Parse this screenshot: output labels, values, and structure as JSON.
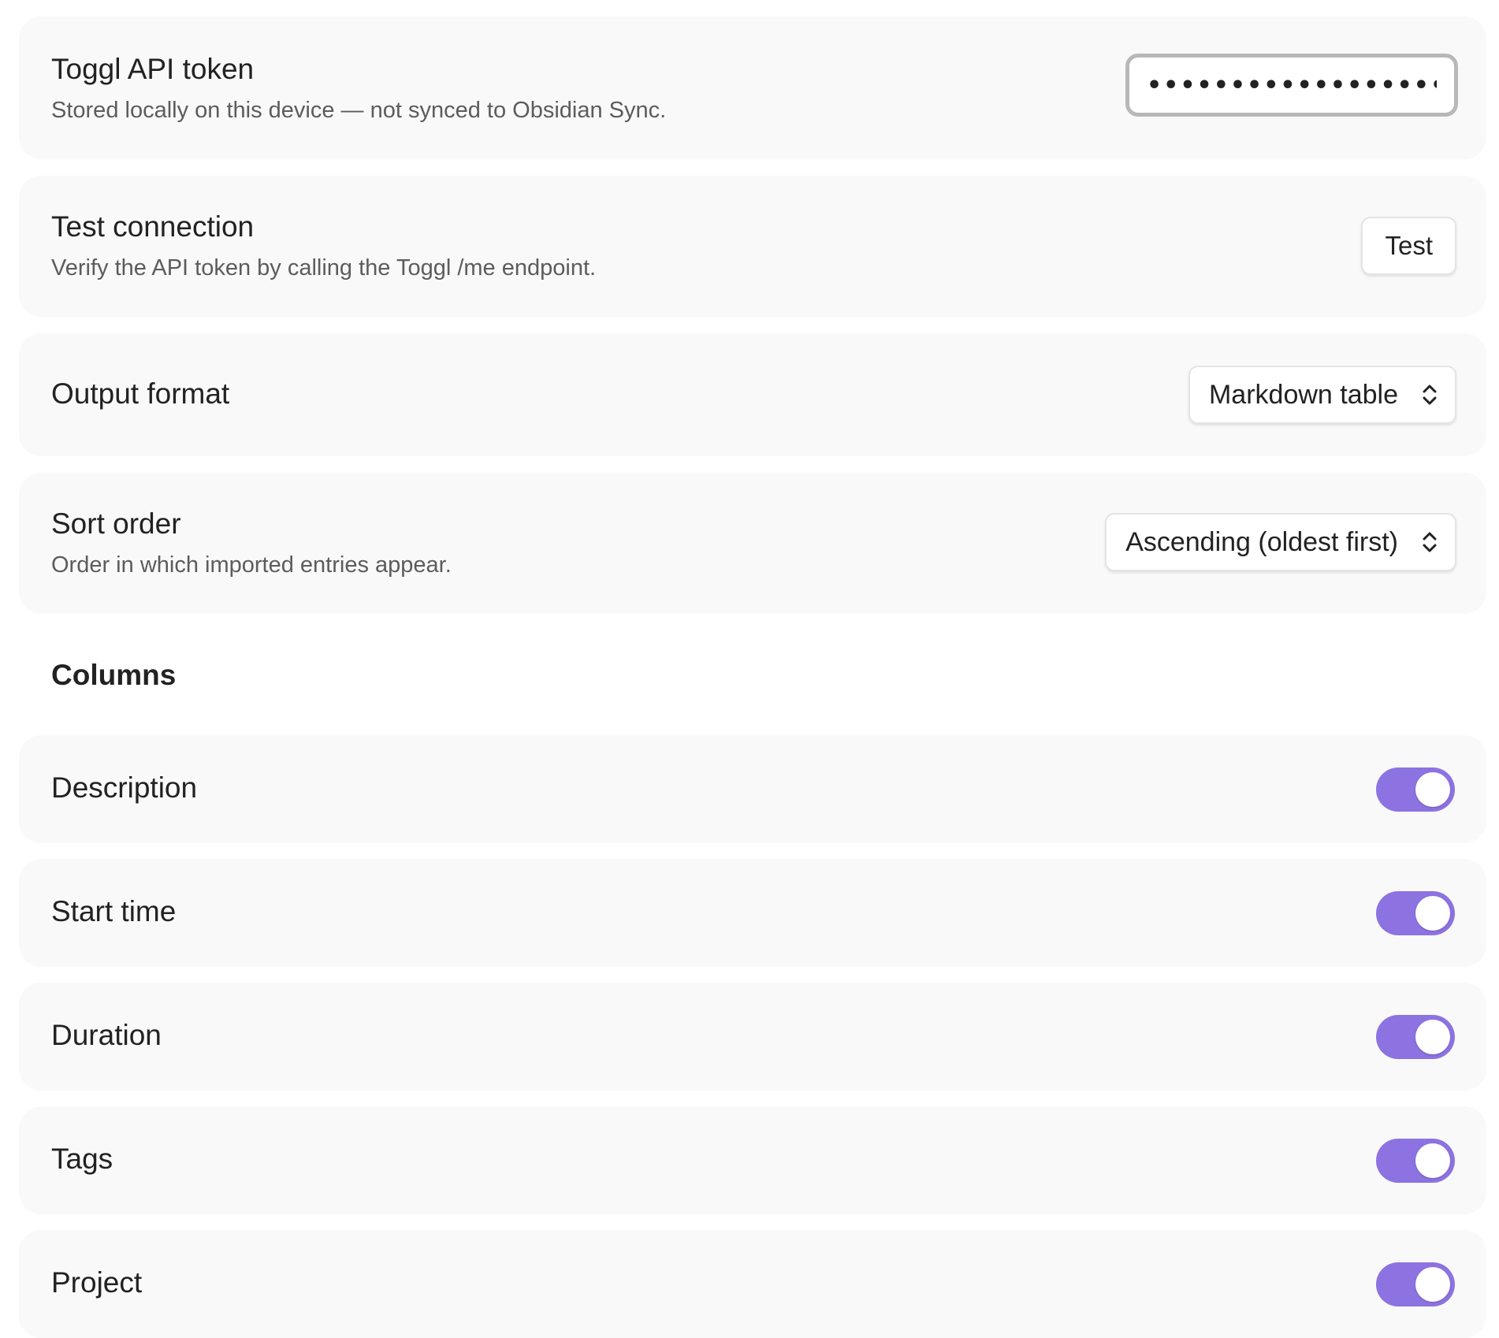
{
  "settings": {
    "api_token": {
      "title": "Toggl API token",
      "description": "Stored locally on this device — not synced to Obsidian Sync.",
      "value": "••••••••••••••••••••••••••"
    },
    "test_connection": {
      "title": "Test connection",
      "description": "Verify the API token by calling the Toggl /me endpoint.",
      "button_label": "Test"
    },
    "output_format": {
      "title": "Output format",
      "selected": "Markdown table",
      "icon": "chevron-up-down-icon"
    },
    "sort_order": {
      "title": "Sort order",
      "description": "Order in which imported entries appear.",
      "selected": "Ascending (oldest first)",
      "icon": "chevron-up-down-icon"
    }
  },
  "columns": {
    "heading": "Columns",
    "items": [
      {
        "label": "Description",
        "enabled": true
      },
      {
        "label": "Start time",
        "enabled": true
      },
      {
        "label": "Duration",
        "enabled": true
      },
      {
        "label": "Tags",
        "enabled": true
      },
      {
        "label": "Project",
        "enabled": true
      }
    ]
  },
  "colors": {
    "accent": "#8d72e1",
    "card_background": "#f9f9f9"
  }
}
